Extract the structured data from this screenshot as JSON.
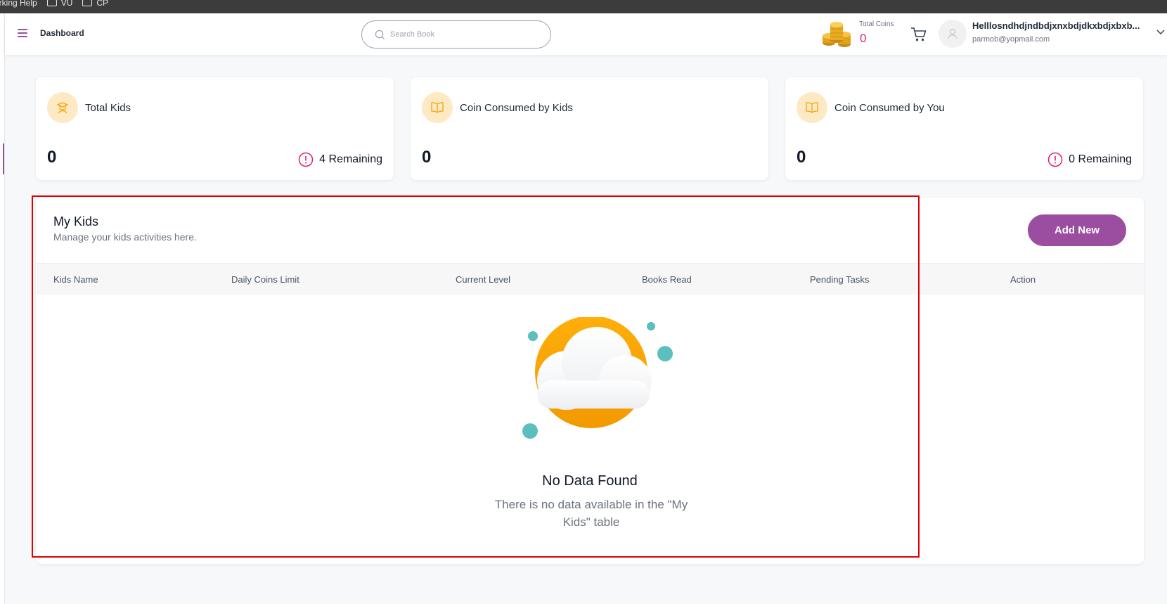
{
  "bookmarks": [
    {
      "label": "orking Help",
      "icon": ""
    },
    {
      "label": "VU",
      "icon": "folder-icon"
    },
    {
      "label": "CP",
      "icon": "folder-icon"
    }
  ],
  "header": {
    "title": "Dashboard",
    "search_placeholder": "Search Book",
    "coins_label": "Total Coins",
    "coins_value": "0",
    "user_name": "Helllosndhdjndbdjxnxbdjdkxbdjxbxb...",
    "user_email": "parmob@yopmail.com"
  },
  "stats": [
    {
      "title": "Total Kids",
      "value": "0",
      "remaining": "4 Remaining",
      "icon": "graduate-icon"
    },
    {
      "title": "Coin Consumed by Kids",
      "value": "0",
      "remaining": "",
      "icon": "book-icon"
    },
    {
      "title": "Coin Consumed by You",
      "value": "0",
      "remaining": "0 Remaining",
      "icon": "book-icon"
    }
  ],
  "kids": {
    "title": "My Kids",
    "subtitle": "Manage your kids activities here.",
    "add_button": "Add New",
    "columns": [
      "Kids Name",
      "Daily Coins Limit",
      "Current Level",
      "Books Read",
      "Pending Tasks",
      "Action"
    ],
    "empty_title": "No Data Found",
    "empty_description": "There is no data available in the \"My Kids\" table"
  },
  "colors": {
    "brand": "#9b4da0",
    "accent_pink": "#e11d74",
    "amber": "#f5a300",
    "teal": "#5bbfbd",
    "highlight": "#e00000"
  }
}
